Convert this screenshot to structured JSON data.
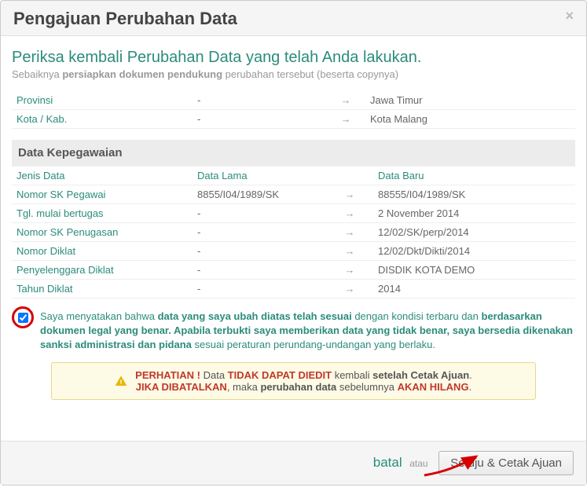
{
  "modal": {
    "title": "Pengajuan Perubahan Data",
    "intro_title": "Periksa kembali Perubahan Data yang telah Anda lakukan.",
    "intro_sub_pre": "Sebaiknya ",
    "intro_sub_bold": "persiapkan dokumen pendukung",
    "intro_sub_post": " perubahan tersebut (beserta copynya)"
  },
  "top_rows": [
    {
      "label": "Provinsi",
      "old": "-",
      "new": "Jawa Timur"
    },
    {
      "label": "Kota / Kab.",
      "old": "-",
      "new": "Kota Malang"
    }
  ],
  "section_title": "Data Kepegawaian",
  "columns": {
    "field": "Jenis Data",
    "old": "Data Lama",
    "new": "Data Baru"
  },
  "rows": [
    {
      "label": "Nomor SK Pegawai",
      "old": "8855/I04/1989/SK",
      "new": "88555/I04/1989/SK"
    },
    {
      "label": "Tgl. mulai bertugas",
      "old": "-",
      "new": "2 November 2014"
    },
    {
      "label": "Nomor SK Penugasan",
      "old": "-",
      "new": "12/02/SK/perp/2014"
    },
    {
      "label": "Nomor Diklat",
      "old": "-",
      "new": "12/02/Dkt/Dikti/2014"
    },
    {
      "label": "Penyelenggara Diklat",
      "old": "-",
      "new": "DISDIK KOTA DEMO"
    },
    {
      "label": "Tahun Diklat",
      "old": "-",
      "new": "2014"
    }
  ],
  "consent": {
    "pre": "Saya menyatakan bahwa ",
    "b1": "data yang saya ubah diatas telah sesuai",
    "mid1": " dengan kondisi terbaru dan ",
    "b2": "berdasarkan dokumen legal yang benar. Apabila terbukti saya memberikan data yang tidak benar, saya bersedia dikenakan sanksi administrasi dan pidana",
    "post": " sesuai peraturan perundang-undangan yang berlaku."
  },
  "warning": {
    "perhatian": "PERHATIAN !",
    "t1": " Data ",
    "r1": "TIDAK DAPAT DIEDIT",
    "t2": " kembali ",
    "b1": "setelah Cetak Ajuan",
    "t3": ".",
    "r2": "JIKA DIBATALKAN",
    "t4": ", maka ",
    "b2": "perubahan data",
    "t5": " sebelumnya ",
    "r3": "AKAN HILANG",
    "t6": "."
  },
  "footer": {
    "cancel": "batal",
    "or": "atau",
    "submit": "Setuju & Cetak Ajuan"
  },
  "arrow_symbol": "→"
}
